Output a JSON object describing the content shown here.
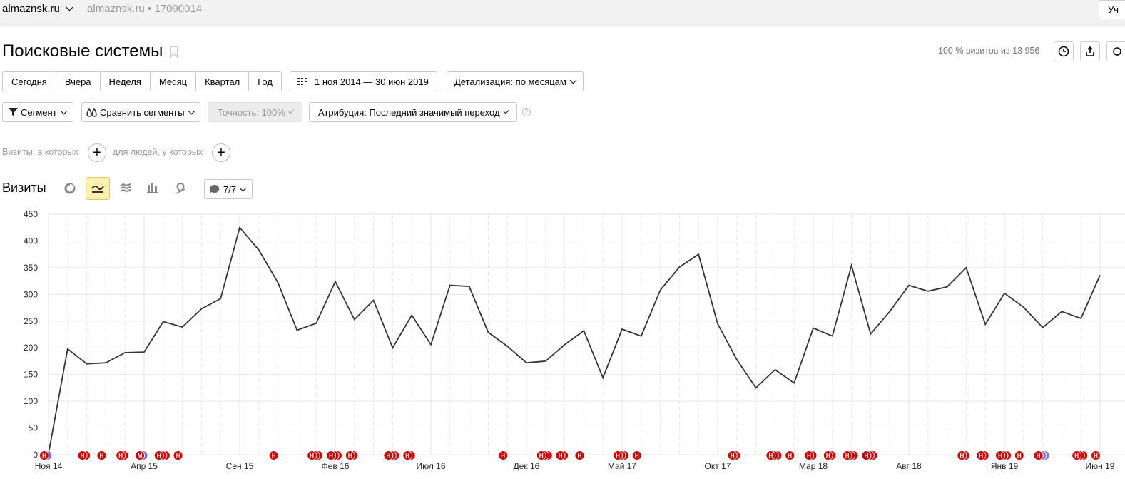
{
  "header": {
    "site": "almaznsk.ru",
    "crumb": "almaznsk.ru • 17090014",
    "right_btn": "Уч"
  },
  "page": {
    "title": "Поисковые системы",
    "visits_summary": "100 % визитов из 13 956"
  },
  "periods": [
    "Сегодня",
    "Вчера",
    "Неделя",
    "Месяц",
    "Квартал",
    "Год"
  ],
  "date_range": "1 ноя 2014 — 30 июн 2019",
  "detail": "Детализация: по месяцам",
  "filters": {
    "segment": "Сегмент",
    "compare": "Сравнить сегменты",
    "accuracy": "Точность: 100%",
    "attribution": "Атрибуция: Последний значимый переход"
  },
  "conditions": {
    "visits": "Визиты, в которых",
    "people": "для людей, у которых"
  },
  "chart_section": {
    "label": "Визиты",
    "notes_count": "7/7"
  },
  "colors": {
    "line": "#333333",
    "note": "#d40000",
    "note_alt": "#7b6fd8",
    "active": "#fcefb0"
  },
  "chart_data": {
    "type": "line",
    "ylim": [
      0,
      450
    ],
    "yticks": [
      0,
      50,
      100,
      150,
      200,
      250,
      300,
      350,
      400,
      450
    ],
    "xlabels": [
      {
        "i": 0,
        "label": "Ноя 14"
      },
      {
        "i": 5,
        "label": "Апр 15"
      },
      {
        "i": 10,
        "label": "Сен 15"
      },
      {
        "i": 15,
        "label": "Фев 16"
      },
      {
        "i": 20,
        "label": "Июл 16"
      },
      {
        "i": 25,
        "label": "Дек 16"
      },
      {
        "i": 30,
        "label": "Май 17"
      },
      {
        "i": 35,
        "label": "Окт 17"
      },
      {
        "i": 40,
        "label": "Мар 18"
      },
      {
        "i": 45,
        "label": "Авг 18"
      },
      {
        "i": 50,
        "label": "Янв 19"
      },
      {
        "i": 55,
        "label": "Июн 19"
      }
    ],
    "series": [
      {
        "values": [
          2,
          198,
          170,
          172,
          191,
          192,
          249,
          239,
          273,
          292,
          425,
          383,
          322,
          233,
          246,
          324,
          253,
          289,
          200,
          261,
          206,
          317,
          315,
          229,
          203,
          172,
          175,
          206,
          232,
          144,
          235,
          222,
          308,
          351,
          375,
          245,
          178,
          125,
          159,
          134,
          237,
          222,
          354,
          226,
          268,
          317,
          306,
          314,
          350,
          244,
          302,
          276,
          238,
          268,
          255,
          336
        ]
      }
    ],
    "grid": true,
    "notes": [
      {
        "i": 0,
        "n": 2,
        "alt": true
      },
      {
        "i": 2,
        "n": 2
      },
      {
        "i": 3,
        "n": 1
      },
      {
        "i": 4,
        "n": 2
      },
      {
        "i": 5,
        "n": 2,
        "alt": true,
        "letter": "М"
      },
      {
        "i": 6,
        "n": 3
      },
      {
        "i": 7,
        "n": 1
      },
      {
        "i": 12,
        "n": 1
      },
      {
        "i": 14,
        "n": 3
      },
      {
        "i": 15,
        "n": 3
      },
      {
        "i": 16,
        "n": 2
      },
      {
        "i": 18,
        "n": 3
      },
      {
        "i": 19,
        "n": 2
      },
      {
        "i": 24,
        "n": 1
      },
      {
        "i": 26,
        "n": 3
      },
      {
        "i": 27,
        "n": 2
      },
      {
        "i": 28,
        "n": 1
      },
      {
        "i": 30,
        "n": 3
      },
      {
        "i": 31,
        "n": 1
      },
      {
        "i": 36,
        "n": 2
      },
      {
        "i": 38,
        "n": 3
      },
      {
        "i": 39,
        "n": 1
      },
      {
        "i": 40,
        "n": 2
      },
      {
        "i": 41,
        "n": 2
      },
      {
        "i": 42,
        "n": 3
      },
      {
        "i": 43,
        "n": 3
      },
      {
        "i": 48,
        "n": 2
      },
      {
        "i": 49,
        "n": 2
      },
      {
        "i": 50,
        "n": 3
      },
      {
        "i": 51,
        "n": 1
      },
      {
        "i": 52,
        "n": 3,
        "alt": true
      },
      {
        "i": 54,
        "n": 3
      },
      {
        "i": 55,
        "n": 1
      }
    ],
    "note_letter": "Н"
  }
}
